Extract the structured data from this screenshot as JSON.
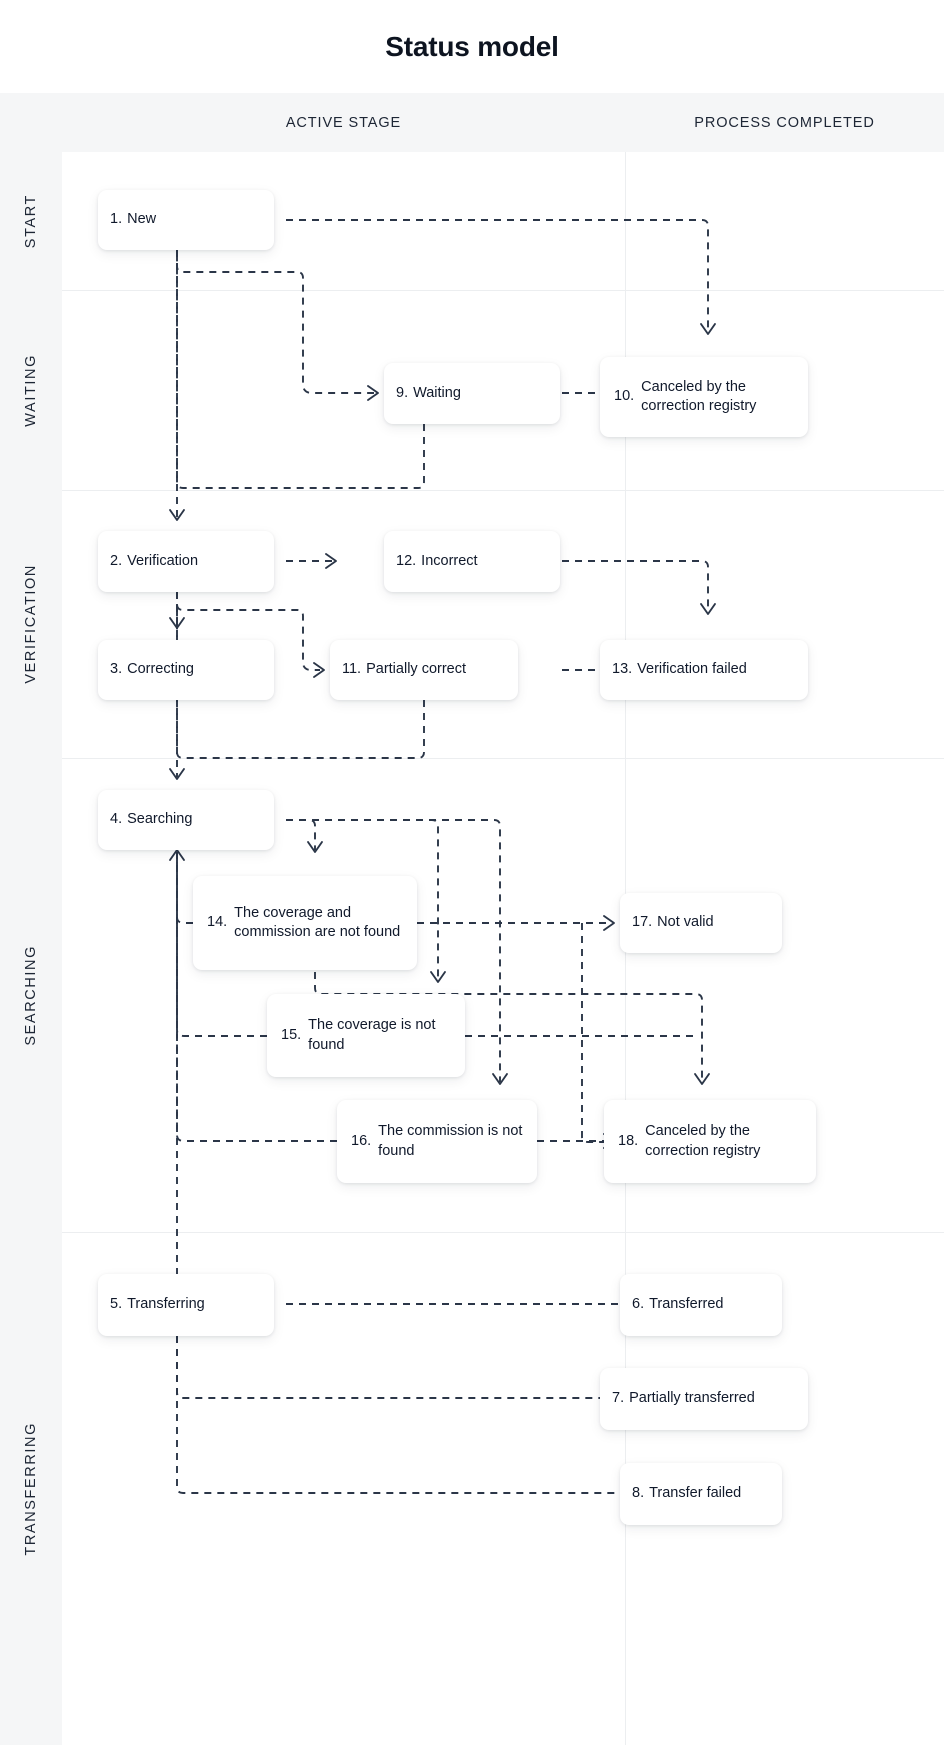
{
  "title": "Status model",
  "columns": [
    {
      "id": "active-stage",
      "label": "ACTIVE STAGE"
    },
    {
      "id": "process-completed",
      "label": "PROCESS COMPLETED"
    }
  ],
  "stages": [
    {
      "id": "start",
      "label": "START"
    },
    {
      "id": "waiting",
      "label": "WAITING"
    },
    {
      "id": "verification",
      "label": "VERIFICATION"
    },
    {
      "id": "searching",
      "label": "SEARCHING"
    },
    {
      "id": "transferring",
      "label": "TRANSFERRING"
    }
  ],
  "nodes": [
    {
      "id": "n1",
      "num": "1.",
      "label": "New",
      "stage": "start",
      "column": "active-stage"
    },
    {
      "id": "n9",
      "num": "9.",
      "label": "Waiting",
      "stage": "waiting",
      "column": "active-stage"
    },
    {
      "id": "n10",
      "num": "10.",
      "label": "Canceled by the correction registry",
      "stage": "waiting",
      "column": "process-completed"
    },
    {
      "id": "n2",
      "num": "2.",
      "label": "Verification",
      "stage": "verification",
      "column": "active-stage"
    },
    {
      "id": "n12",
      "num": "12.",
      "label": "Incorrect",
      "stage": "verification",
      "column": "active-stage"
    },
    {
      "id": "n3",
      "num": "3.",
      "label": "Correcting",
      "stage": "verification",
      "column": "active-stage"
    },
    {
      "id": "n11",
      "num": "11.",
      "label": "Partially correct",
      "stage": "verification",
      "column": "active-stage"
    },
    {
      "id": "n13",
      "num": "13.",
      "label": "Verification failed",
      "stage": "verification",
      "column": "process-completed"
    },
    {
      "id": "n4",
      "num": "4.",
      "label": "Searching",
      "stage": "searching",
      "column": "active-stage"
    },
    {
      "id": "n14",
      "num": "14.",
      "label": "The coverage and commission are not found",
      "stage": "searching",
      "column": "active-stage"
    },
    {
      "id": "n17",
      "num": "17.",
      "label": "Not valid",
      "stage": "searching",
      "column": "process-completed"
    },
    {
      "id": "n15",
      "num": "15.",
      "label": "The coverage is not found",
      "stage": "searching",
      "column": "active-stage"
    },
    {
      "id": "n16",
      "num": "16.",
      "label": "The commission is not found",
      "stage": "searching",
      "column": "active-stage"
    },
    {
      "id": "n18",
      "num": "18.",
      "label": "Canceled by the correction registry",
      "stage": "searching",
      "column": "process-completed"
    },
    {
      "id": "n5",
      "num": "5.",
      "label": "Transferring",
      "stage": "transferring",
      "column": "active-stage"
    },
    {
      "id": "n6",
      "num": "6.",
      "label": "Transferred",
      "stage": "transferring",
      "column": "process-completed"
    },
    {
      "id": "n7",
      "num": "7.",
      "label": "Partially transferred",
      "stage": "transferring",
      "column": "process-completed"
    },
    {
      "id": "n8",
      "num": "8.",
      "label": "Transfer failed",
      "stage": "transferring",
      "column": "process-completed"
    }
  ],
  "edges": [
    {
      "from": "n1",
      "to": "n10"
    },
    {
      "from": "n1",
      "to": "n9"
    },
    {
      "from": "n1",
      "to": "n2"
    },
    {
      "from": "n9",
      "to": "n10"
    },
    {
      "from": "n9",
      "to": "n2"
    },
    {
      "from": "n2",
      "to": "n12"
    },
    {
      "from": "n2",
      "to": "n3"
    },
    {
      "from": "n12",
      "to": "n13"
    },
    {
      "from": "n2",
      "to": "n11"
    },
    {
      "from": "n11",
      "to": "n13"
    },
    {
      "from": "n3",
      "to": "n4"
    },
    {
      "from": "n11",
      "to": "n4"
    },
    {
      "from": "n4",
      "to": "n14"
    },
    {
      "from": "n4",
      "to": "n15"
    },
    {
      "from": "n4",
      "to": "n16"
    },
    {
      "from": "n14",
      "to": "n17"
    },
    {
      "from": "n15",
      "to": "n18"
    },
    {
      "from": "n16",
      "to": "n18"
    },
    {
      "from": "n14",
      "to": "n4"
    },
    {
      "from": "n15",
      "to": "n4"
    },
    {
      "from": "n16",
      "to": "n4"
    },
    {
      "from": "n4",
      "to": "n5"
    },
    {
      "from": "n5",
      "to": "n6"
    },
    {
      "from": "n5",
      "to": "n7"
    },
    {
      "from": "n5",
      "to": "n8"
    }
  ],
  "colors": {
    "background": "#ffffff",
    "band": "#f5f6f7",
    "text": "#10192b",
    "edge": "#2b3648",
    "divider": "#eceef0"
  }
}
